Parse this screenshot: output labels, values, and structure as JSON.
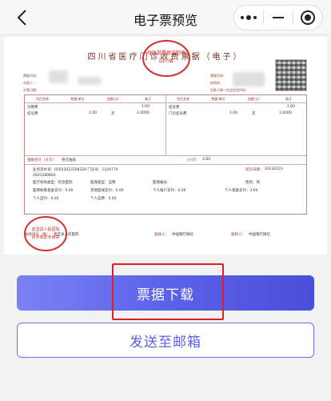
{
  "navbar": {
    "title": "电子票预览"
  },
  "invoice": {
    "title": "四川省医疗门诊收费票据（电子）",
    "seal_top_text": "财政部票据监制章",
    "seal_top_sub": "四川省",
    "seal_bottom_text": "金堂县人民医院",
    "seal_bottom_sub": "财务收费专用章",
    "meta_left": [
      "票据代码：",
      "交款人：",
      "开票日期："
    ],
    "meta_right": [
      "票据号码：",
      "校验码：",
      "交款人统一社会信用代码："
    ],
    "headers": [
      "项目名称",
      "数量/单位",
      "金额(元)",
      "备注",
      "项目名称",
      "数量/单位",
      "金额(元)",
      "备注"
    ],
    "items_left": [
      {
        "name": "诊察费",
        "qty": "",
        "unit": "",
        "amount": "1.00"
      },
      {
        "name": "挂号费",
        "qty": "1.00",
        "unit": "次",
        "amount": "2.0000"
      }
    ],
    "items_right": [
      {
        "name": "挂号费",
        "qty": "",
        "unit": "",
        "amount": "2.00"
      },
      {
        "name": "门诊挂号费",
        "qty": "1.00",
        "unit": "次",
        "amount": "1.0000"
      }
    ],
    "total_label": "金额合计（大写）",
    "total_upper": "叁元陆角",
    "total_small_label": "（小写）",
    "total_small": "3.60",
    "other_info": [
      "业务流水号：02023023108328 门诊号：1104770",
      "2601280862",
      "医疗机构类型：综合医院",
      "医保类型：自费",
      "医保编号：",
      "性别：男",
      "医保统筹基金支付：0.00",
      "其他医保支付：0.00",
      "个人账户支付：0.00",
      "个人现金支付：3.60",
      "个人自付：0.00",
      "个人自费：0.00"
    ],
    "date_label": "就诊日期：",
    "date": "20230223",
    "payee_label": "收款单位（章）",
    "payee": "金堂县人民医院",
    "reviewer_label": "复核人：",
    "reviewer": "中国银行微信",
    "collector_label": "收款人：",
    "collector": "中国银行微信"
  },
  "actions": {
    "download_label": "票据下载",
    "email_label": "发送至邮箱"
  },
  "colors": {
    "accent": "#5b62e8",
    "highlight": "#e02020",
    "seal": "#d0312d"
  }
}
